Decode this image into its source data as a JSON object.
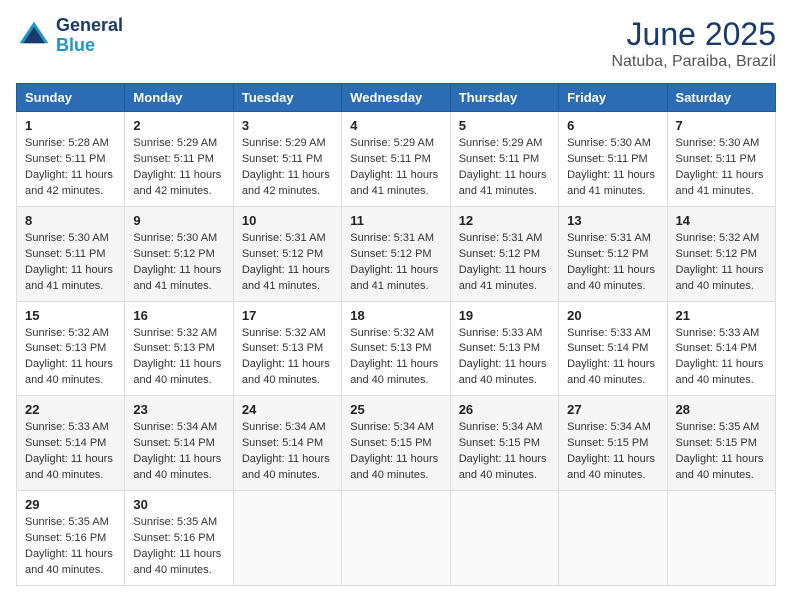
{
  "header": {
    "logo_line1": "General",
    "logo_line2": "Blue",
    "month": "June 2025",
    "location": "Natuba, Paraiba, Brazil"
  },
  "weekdays": [
    "Sunday",
    "Monday",
    "Tuesday",
    "Wednesday",
    "Thursday",
    "Friday",
    "Saturday"
  ],
  "weeks": [
    [
      {
        "day": 1,
        "rise": "5:28 AM",
        "set": "5:11 PM",
        "hours": "11",
        "mins": "42"
      },
      {
        "day": 2,
        "rise": "5:29 AM",
        "set": "5:11 PM",
        "hours": "11",
        "mins": "42"
      },
      {
        "day": 3,
        "rise": "5:29 AM",
        "set": "5:11 PM",
        "hours": "11",
        "mins": "42"
      },
      {
        "day": 4,
        "rise": "5:29 AM",
        "set": "5:11 PM",
        "hours": "11",
        "mins": "41"
      },
      {
        "day": 5,
        "rise": "5:29 AM",
        "set": "5:11 PM",
        "hours": "11",
        "mins": "41"
      },
      {
        "day": 6,
        "rise": "5:30 AM",
        "set": "5:11 PM",
        "hours": "11",
        "mins": "41"
      },
      {
        "day": 7,
        "rise": "5:30 AM",
        "set": "5:11 PM",
        "hours": "11",
        "mins": "41"
      }
    ],
    [
      {
        "day": 8,
        "rise": "5:30 AM",
        "set": "5:11 PM",
        "hours": "11",
        "mins": "41"
      },
      {
        "day": 9,
        "rise": "5:30 AM",
        "set": "5:12 PM",
        "hours": "11",
        "mins": "41"
      },
      {
        "day": 10,
        "rise": "5:31 AM",
        "set": "5:12 PM",
        "hours": "11",
        "mins": "41"
      },
      {
        "day": 11,
        "rise": "5:31 AM",
        "set": "5:12 PM",
        "hours": "11",
        "mins": "41"
      },
      {
        "day": 12,
        "rise": "5:31 AM",
        "set": "5:12 PM",
        "hours": "11",
        "mins": "41"
      },
      {
        "day": 13,
        "rise": "5:31 AM",
        "set": "5:12 PM",
        "hours": "11",
        "mins": "40"
      },
      {
        "day": 14,
        "rise": "5:32 AM",
        "set": "5:12 PM",
        "hours": "11",
        "mins": "40"
      }
    ],
    [
      {
        "day": 15,
        "rise": "5:32 AM",
        "set": "5:13 PM",
        "hours": "11",
        "mins": "40"
      },
      {
        "day": 16,
        "rise": "5:32 AM",
        "set": "5:13 PM",
        "hours": "11",
        "mins": "40"
      },
      {
        "day": 17,
        "rise": "5:32 AM",
        "set": "5:13 PM",
        "hours": "11",
        "mins": "40"
      },
      {
        "day": 18,
        "rise": "5:32 AM",
        "set": "5:13 PM",
        "hours": "11",
        "mins": "40"
      },
      {
        "day": 19,
        "rise": "5:33 AM",
        "set": "5:13 PM",
        "hours": "11",
        "mins": "40"
      },
      {
        "day": 20,
        "rise": "5:33 AM",
        "set": "5:14 PM",
        "hours": "11",
        "mins": "40"
      },
      {
        "day": 21,
        "rise": "5:33 AM",
        "set": "5:14 PM",
        "hours": "11",
        "mins": "40"
      }
    ],
    [
      {
        "day": 22,
        "rise": "5:33 AM",
        "set": "5:14 PM",
        "hours": "11",
        "mins": "40"
      },
      {
        "day": 23,
        "rise": "5:34 AM",
        "set": "5:14 PM",
        "hours": "11",
        "mins": "40"
      },
      {
        "day": 24,
        "rise": "5:34 AM",
        "set": "5:14 PM",
        "hours": "11",
        "mins": "40"
      },
      {
        "day": 25,
        "rise": "5:34 AM",
        "set": "5:15 PM",
        "hours": "11",
        "mins": "40"
      },
      {
        "day": 26,
        "rise": "5:34 AM",
        "set": "5:15 PM",
        "hours": "11",
        "mins": "40"
      },
      {
        "day": 27,
        "rise": "5:34 AM",
        "set": "5:15 PM",
        "hours": "11",
        "mins": "40"
      },
      {
        "day": 28,
        "rise": "5:35 AM",
        "set": "5:15 PM",
        "hours": "11",
        "mins": "40"
      }
    ],
    [
      {
        "day": 29,
        "rise": "5:35 AM",
        "set": "5:16 PM",
        "hours": "11",
        "mins": "40"
      },
      {
        "day": 30,
        "rise": "5:35 AM",
        "set": "5:16 PM",
        "hours": "11",
        "mins": "40"
      },
      null,
      null,
      null,
      null,
      null
    ]
  ]
}
